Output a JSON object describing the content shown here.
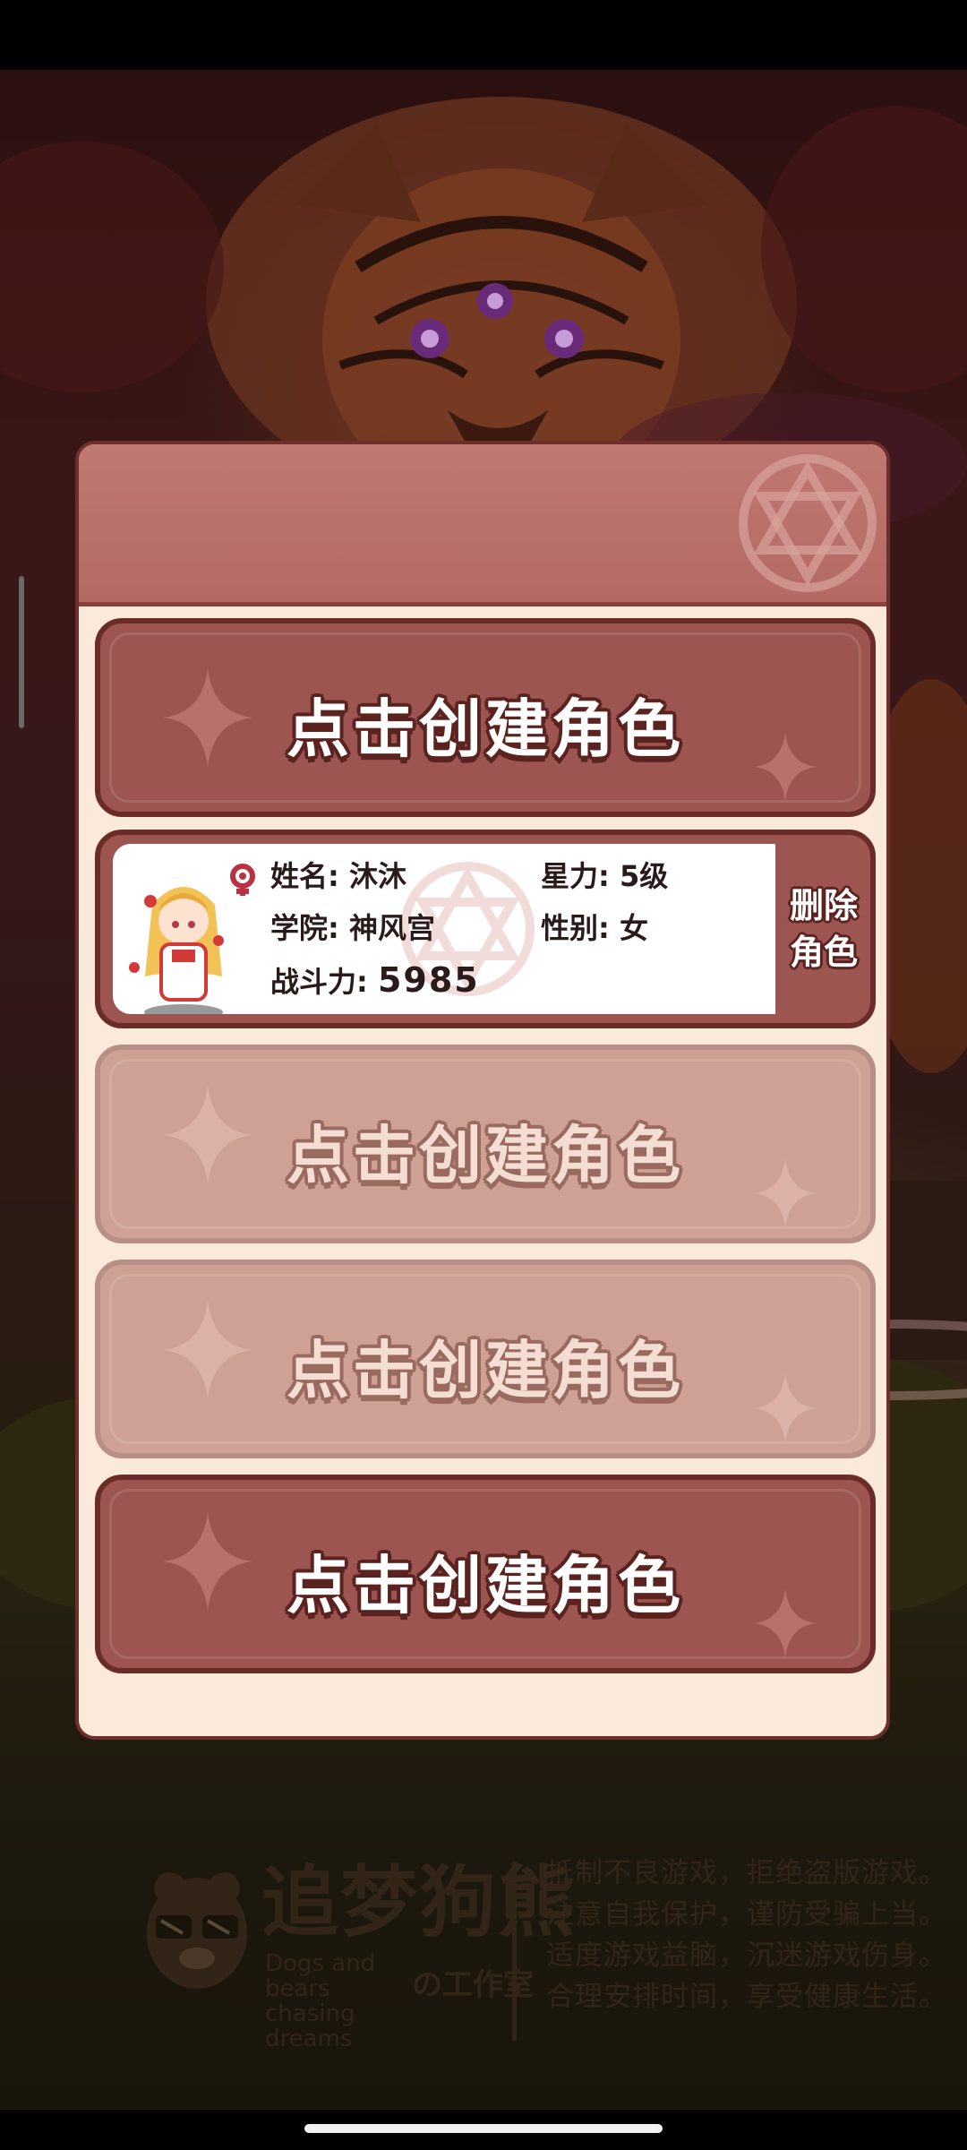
{
  "slots": {
    "slot1_label": "点击创建角色",
    "slot3_label": "点击创建角色",
    "slot4_label": "点击创建角色",
    "slot5_label": "点击创建角色"
  },
  "character": {
    "name_label": "姓名: 沐沐",
    "star_label": "星力: 5级",
    "academy_label": "学院: 神风宫",
    "gender_label": "性别: 女",
    "power_prefix": "战斗力: ",
    "power_value": "5985",
    "delete_line1": "删除",
    "delete_line2": "角色",
    "gender_icon": "female-icon"
  },
  "logo": {
    "title": "追梦狗熊",
    "english": "Dogs and bears chasing dreams",
    "studio": "の工作室",
    "advisory": [
      "抵制不良游戏，拒绝盗版游戏。",
      "注意自我保护，谨防受骗上当。",
      "适度游戏益脑，沉迷游戏伤身。",
      "合理安排时间，享受健康生活。"
    ]
  },
  "colors": {
    "panel_bg": "#fbe9d9",
    "panel_border": "#6e2f2c",
    "slot_active": "#9c5550",
    "slot_dim": "#cfa196"
  }
}
